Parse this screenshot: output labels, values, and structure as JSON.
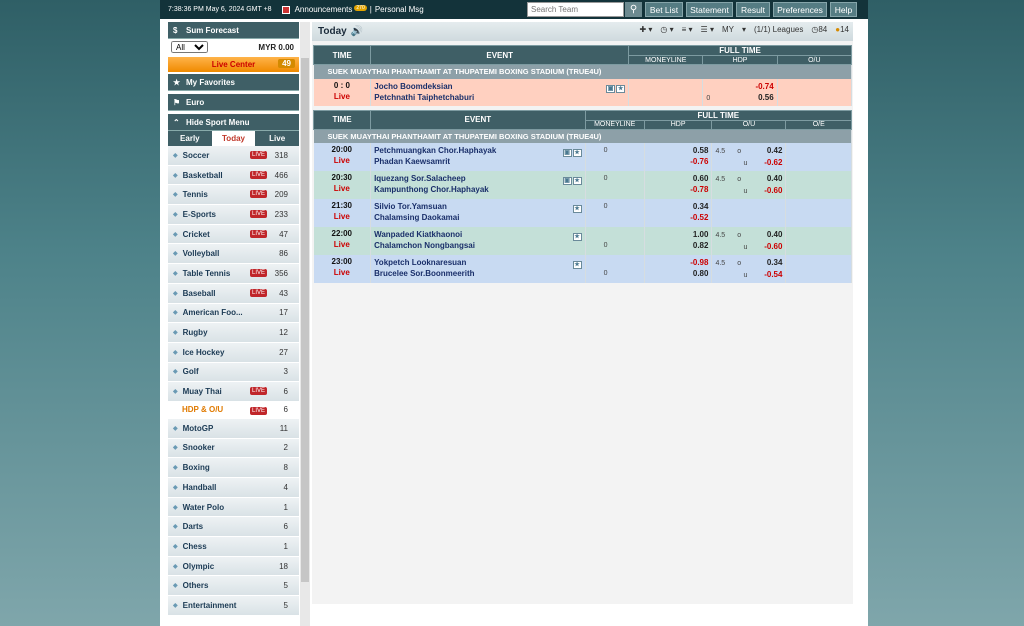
{
  "topbar": {
    "clock": "7:38:36 PM May 6, 2024 GMT +8",
    "announcements": "Announcements",
    "ann_badge": "270",
    "personal_msg": "Personal Msg",
    "search_placeholder": "Search Team",
    "buttons": [
      "Bet List",
      "Statement",
      "Result",
      "Preferences",
      "Help"
    ]
  },
  "sidebar": {
    "sum_forecast": "Sum Forecast",
    "filter": "All",
    "balance": "MYR 0.00",
    "live_center": "Live Center",
    "live_count": "49",
    "favorites": "My Favorites",
    "euro": "Euro",
    "hide_menu": "Hide Sport Menu",
    "tabs": [
      "Early",
      "Today",
      "Live"
    ],
    "sports": [
      {
        "name": "Soccer",
        "live": "LIVE",
        "count": "318"
      },
      {
        "name": "Basketball",
        "live": "LIVE",
        "count": "466"
      },
      {
        "name": "Tennis",
        "live": "LIVE",
        "count": "209"
      },
      {
        "name": "E-Sports",
        "live": "LIVE",
        "count": "233"
      },
      {
        "name": "Cricket",
        "live": "LIVE",
        "count": "47"
      },
      {
        "name": "Volleyball",
        "live": "",
        "count": "86"
      },
      {
        "name": "Table Tennis",
        "live": "LIVE",
        "count": "356"
      },
      {
        "name": "Baseball",
        "live": "LIVE",
        "count": "43"
      },
      {
        "name": "American Foo...",
        "live": "",
        "count": "17"
      },
      {
        "name": "Rugby",
        "live": "",
        "count": "12"
      },
      {
        "name": "Ice Hockey",
        "live": "",
        "count": "27"
      },
      {
        "name": "Golf",
        "live": "",
        "count": "3"
      },
      {
        "name": "Muay Thai",
        "live": "LIVE",
        "count": "6"
      },
      {
        "name": "HDP & O/U",
        "live": "LIVE",
        "count": "6"
      },
      {
        "name": "MotoGP",
        "live": "",
        "count": "11"
      },
      {
        "name": "Snooker",
        "live": "",
        "count": "2"
      },
      {
        "name": "Boxing",
        "live": "",
        "count": "8"
      },
      {
        "name": "Handball",
        "live": "",
        "count": "4"
      },
      {
        "name": "Water Polo",
        "live": "",
        "count": "1"
      },
      {
        "name": "Darts",
        "live": "",
        "count": "6"
      },
      {
        "name": "Chess",
        "live": "",
        "count": "1"
      },
      {
        "name": "Olympic",
        "live": "",
        "count": "18"
      },
      {
        "name": "Others",
        "live": "",
        "count": "5"
      },
      {
        "name": "Entertainment",
        "live": "",
        "count": "5"
      }
    ]
  },
  "main": {
    "title": "Today",
    "odds_type": "MY",
    "leagues": "(1/1) Leagues",
    "count_a": "84",
    "count_b": "14",
    "headers": {
      "time": "TIME",
      "event": "EVENT",
      "full_time": "FULL TIME",
      "moneyline": "MONEYLINE",
      "hdp": "HDP",
      "ou": "O/U",
      "oe": "O/E"
    },
    "league": "SUEK MUAYTHAI PHANTHAMIT AT THUPATEMI BOXING STADIUM (TRUE4U)",
    "live_match": {
      "score": "0 : 0",
      "status": "Live",
      "home": "Jocho Boomdeksian",
      "away": "Petchnathi Taiphetchaburi",
      "hdp_line": "0",
      "hdp_home": "-0.74",
      "hdp_away": "0.56"
    },
    "matches": [
      {
        "time": "20:00",
        "status": "Live",
        "home": "Petchmuangkan Chor.Haphayak",
        "away": "Phadan Kaewsamrit",
        "hdp_line": "0",
        "hdp_home": "0.58",
        "hdp_away": "-0.76",
        "ou_line": "4.5",
        "ou_o": "o",
        "ou_u": "u",
        "ou_over": "0.42",
        "ou_under": "-0.62",
        "line_row": "home"
      },
      {
        "time": "20:30",
        "status": "Live",
        "home": "Iquezang Sor.Salacheep",
        "away": "Kampunthong Chor.Haphayak",
        "hdp_line": "0",
        "hdp_home": "0.60",
        "hdp_away": "-0.78",
        "ou_line": "4.5",
        "ou_o": "o",
        "ou_u": "u",
        "ou_over": "0.40",
        "ou_under": "-0.60",
        "line_row": "home"
      },
      {
        "time": "21:30",
        "status": "Live",
        "home": "Silvio Tor.Yamsuan",
        "away": "Chalamsing Daokamai",
        "hdp_line": "0",
        "hdp_home": "0.34",
        "hdp_away": "-0.52",
        "ou_line": "",
        "ou_o": "",
        "ou_u": "",
        "ou_over": "",
        "ou_under": "",
        "line_row": "home"
      },
      {
        "time": "22:00",
        "status": "Live",
        "home": "Wanpaded Kiatkhaonoi",
        "away": "Chalamchon Nongbangsai",
        "hdp_line": "0",
        "hdp_home": "1.00",
        "hdp_away": "0.82",
        "ou_line": "4.5",
        "ou_o": "o",
        "ou_u": "u",
        "ou_over": "0.40",
        "ou_under": "-0.60",
        "line_row": "away"
      },
      {
        "time": "23:00",
        "status": "Live",
        "home": "Yokpetch Looknaresuan",
        "away": "Brucelee Sor.Boonmeerith",
        "hdp_line": "0",
        "hdp_home": "-0.98",
        "hdp_away": "0.80",
        "ou_line": "4.5",
        "ou_o": "o",
        "ou_u": "u",
        "ou_over": "0.34",
        "ou_under": "-0.54",
        "line_row": "away"
      }
    ]
  }
}
